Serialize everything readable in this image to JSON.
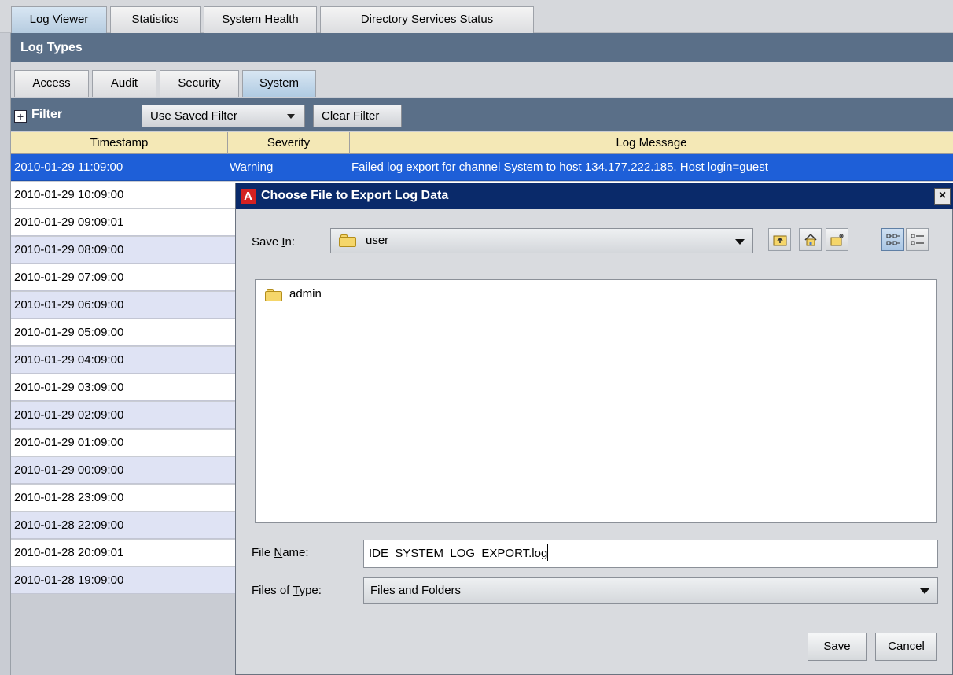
{
  "top_tabs": [
    {
      "label": "Log Viewer",
      "active": true
    },
    {
      "label": "Statistics",
      "active": false
    },
    {
      "label": "System Health",
      "active": false
    },
    {
      "label": "Directory Services Status",
      "active": false
    }
  ],
  "log_types": {
    "title": "Log Types",
    "tabs": [
      {
        "label": "Access",
        "active": false
      },
      {
        "label": "Audit",
        "active": false
      },
      {
        "label": "Security",
        "active": false
      },
      {
        "label": "System",
        "active": true
      }
    ]
  },
  "filter": {
    "label": "Filter",
    "expand_glyph": "+",
    "saved_filter_label": "Use Saved Filter",
    "clear_filter_label": "Clear Filter"
  },
  "table": {
    "columns": [
      "Timestamp",
      "Severity",
      "Log Message"
    ],
    "rows": [
      {
        "timestamp": "2010-01-29 11:09:00",
        "severity": "Warning",
        "message": "Failed log export for channel System to host 134.177.222.185.  Host login=guest",
        "selected": true
      },
      {
        "timestamp": "2010-01-29 10:09:00",
        "severity": "",
        "message": ""
      },
      {
        "timestamp": "2010-01-29 09:09:01",
        "severity": "",
        "message": ""
      },
      {
        "timestamp": "2010-01-29 08:09:00",
        "severity": "",
        "message": ""
      },
      {
        "timestamp": "2010-01-29 07:09:00",
        "severity": "",
        "message": ""
      },
      {
        "timestamp": "2010-01-29 06:09:00",
        "severity": "",
        "message": ""
      },
      {
        "timestamp": "2010-01-29 05:09:00",
        "severity": "",
        "message": ""
      },
      {
        "timestamp": "2010-01-29 04:09:00",
        "severity": "",
        "message": ""
      },
      {
        "timestamp": "2010-01-29 03:09:00",
        "severity": "",
        "message": ""
      },
      {
        "timestamp": "2010-01-29 02:09:00",
        "severity": "",
        "message": ""
      },
      {
        "timestamp": "2010-01-29 01:09:00",
        "severity": "",
        "message": ""
      },
      {
        "timestamp": "2010-01-29 00:09:00",
        "severity": "",
        "message": ""
      },
      {
        "timestamp": "2010-01-28 23:09:00",
        "severity": "",
        "message": ""
      },
      {
        "timestamp": "2010-01-28 22:09:00",
        "severity": "",
        "message": ""
      },
      {
        "timestamp": "2010-01-28 20:09:01",
        "severity": "",
        "message": ""
      },
      {
        "timestamp": "2010-01-28 19:09:00",
        "severity": "",
        "message": ""
      }
    ]
  },
  "dialog": {
    "title": "Choose File to Export Log Data",
    "app_icon_letter": "A",
    "close_glyph": "×",
    "save_in_label_pre": "Save ",
    "save_in_label_mnemonic": "I",
    "save_in_label_post": "n:",
    "save_in_value": "user",
    "toolbar_icons": [
      "up-folder-icon",
      "home-icon",
      "new-folder-icon",
      "list-view-icon",
      "details-view-icon"
    ],
    "files": [
      {
        "name": "admin",
        "type": "folder"
      }
    ],
    "file_name_label_pre": "File ",
    "file_name_label_mnemonic": "N",
    "file_name_label_post": "ame:",
    "file_name_value": "IDE_SYSTEM_LOG_EXPORT.log",
    "files_of_type_label_pre": "Files of ",
    "files_of_type_label_mnemonic": "T",
    "files_of_type_label_post": "ype:",
    "files_of_type_value": "Files and Folders",
    "save_label": "Save",
    "cancel_label": "Cancel"
  },
  "colors": {
    "header_bar": "#5a6f88",
    "dialog_title_bar": "#0a2a6a",
    "selection": "#1e5fd8",
    "table_header": "#f4e8b6",
    "row_stripe": "#dfe3f4"
  }
}
